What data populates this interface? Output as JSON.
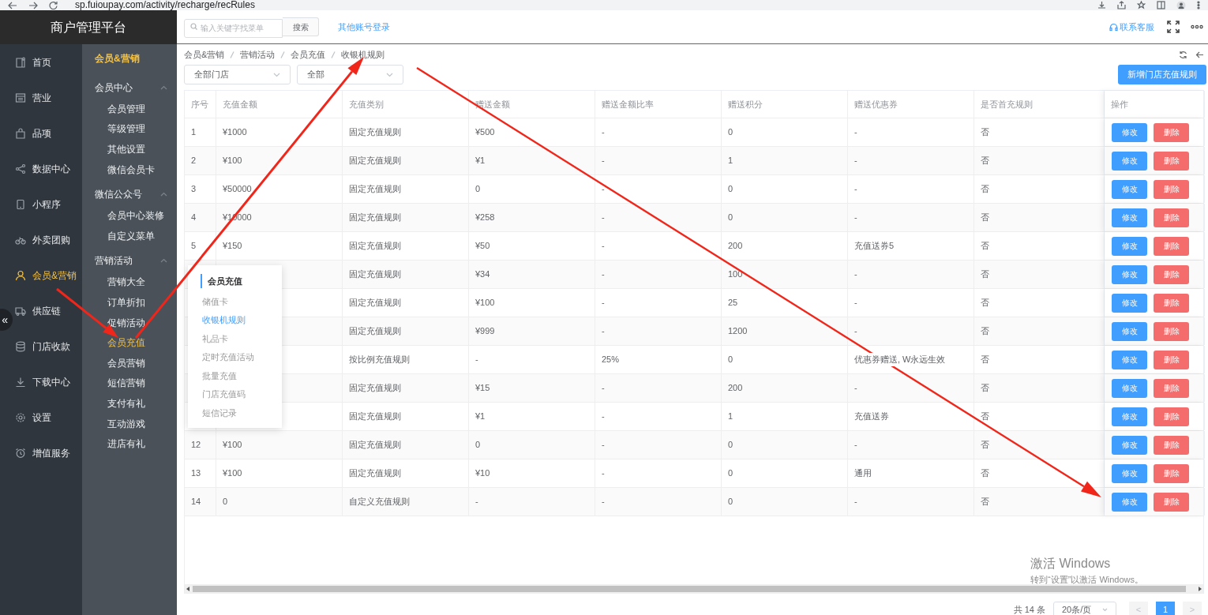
{
  "browser": {
    "url": "sp.fuioupay.com/activity/recharge/recRules"
  },
  "app_title": "商户管理平台",
  "nav": [
    {
      "label": "首页",
      "selected": false
    },
    {
      "label": "营业",
      "selected": false
    },
    {
      "label": "品项",
      "selected": false
    },
    {
      "label": "数据中心",
      "selected": false
    },
    {
      "label": "小程序",
      "selected": false
    },
    {
      "label": "外卖团购",
      "selected": false
    },
    {
      "label": "会员&营销",
      "selected": true
    },
    {
      "label": "供应链",
      "selected": false
    },
    {
      "label": "门店收款",
      "selected": false
    },
    {
      "label": "下载中心",
      "selected": false
    },
    {
      "label": "设置",
      "selected": false
    },
    {
      "label": "增值服务",
      "selected": false
    }
  ],
  "collapse_button": "«",
  "subnav": {
    "title": "会员&营销",
    "groups": [
      {
        "label": "会员中心",
        "expanded": true,
        "children": [
          {
            "label": "会员管理",
            "selected": false
          },
          {
            "label": "等级管理",
            "selected": false
          },
          {
            "label": "其他设置",
            "selected": false
          },
          {
            "label": "微信会员卡",
            "selected": false
          }
        ]
      },
      {
        "label": "微信公众号",
        "expanded": true,
        "children": [
          {
            "label": "会员中心装修",
            "selected": false
          },
          {
            "label": "自定义菜单",
            "selected": false
          }
        ]
      },
      {
        "label": "营销活动",
        "expanded": true,
        "children": [
          {
            "label": "营销大全",
            "selected": false
          },
          {
            "label": "订单折扣",
            "selected": false
          },
          {
            "label": "促销活动",
            "selected": false
          },
          {
            "label": "会员充值",
            "selected": true
          },
          {
            "label": "会员营销",
            "selected": false
          },
          {
            "label": "短信营销",
            "selected": false
          },
          {
            "label": "支付有礼",
            "selected": false
          },
          {
            "label": "互动游戏",
            "selected": false
          },
          {
            "label": "进店有礼",
            "selected": false
          }
        ]
      }
    ]
  },
  "topbar": {
    "search": {
      "placeholder": "输入关键字找菜单",
      "button": "搜索"
    },
    "link": "其他账号登录",
    "support": "联系客服"
  },
  "breadcrumb": [
    "会员&营销",
    "营销活动",
    "会员充值",
    "收银机规则"
  ],
  "filters": [
    {
      "value": "全部门店"
    },
    {
      "value": "全部"
    }
  ],
  "add_button": "新增门店充值规则",
  "table": {
    "columns": [
      "序号",
      "充值金额",
      "充值类别",
      "赠送金额",
      "赠送金额比率",
      "赠送积分",
      "赠送优惠券",
      "是否首充规则",
      "操作"
    ],
    "rows": [
      {
        "no": "1",
        "amount": "¥1000",
        "type": "固定充值规则",
        "bonus": "¥500",
        "ratio": "-",
        "points": "0",
        "coupon": "-",
        "first": "否",
        "actions": [
          "修改",
          "删除"
        ]
      },
      {
        "no": "2",
        "amount": "¥100",
        "type": "固定充值规则",
        "bonus": "¥1",
        "ratio": "-",
        "points": "1",
        "coupon": "-",
        "first": "否",
        "actions": [
          "修改",
          "删除"
        ]
      },
      {
        "no": "3",
        "amount": "¥50000",
        "type": "固定充值规则",
        "bonus": "0",
        "ratio": "-",
        "points": "0",
        "coupon": "-",
        "first": "否",
        "actions": [
          "修改",
          "删除"
        ]
      },
      {
        "no": "4",
        "amount": "¥10000",
        "type": "固定充值规则",
        "bonus": "¥258",
        "ratio": "-",
        "points": "0",
        "coupon": "-",
        "first": "否",
        "actions": [
          "修改",
          "删除"
        ]
      },
      {
        "no": "5",
        "amount": "¥150",
        "type": "固定充值规则",
        "bonus": "¥50",
        "ratio": "-",
        "points": "200",
        "coupon": "充值送券5",
        "first": "否",
        "actions": [
          "修改",
          "删除"
        ]
      },
      {
        "type": "固定充值规则",
        "bonus": "¥34",
        "ratio": "-",
        "points": "100",
        "coupon": "-",
        "first": "否",
        "actions": [
          "修改",
          "删除"
        ]
      },
      {
        "type": "固定充值规则",
        "bonus": "¥100",
        "ratio": "-",
        "points": "25",
        "coupon": "-",
        "first": "否",
        "actions": [
          "修改",
          "删除"
        ]
      },
      {
        "type": "固定充值规则",
        "bonus": "¥999",
        "ratio": "-",
        "points": "1200",
        "coupon": "-",
        "first": "否",
        "actions": [
          "修改",
          "删除"
        ]
      },
      {
        "type": "按比例充值规则",
        "bonus": "-",
        "ratio": "25%",
        "points": "0",
        "coupon": "优惠券赠送, W永远生效",
        "first": "否",
        "actions": [
          "修改",
          "删除"
        ]
      },
      {
        "type": "固定充值规则",
        "bonus": "¥15",
        "ratio": "-",
        "points": "200",
        "coupon": "-",
        "first": "否",
        "actions": [
          "修改",
          "删除"
        ]
      },
      {
        "type": "固定充值规则",
        "bonus": "¥1",
        "ratio": "-",
        "points": "1",
        "coupon": "充值送券",
        "first": "否",
        "actions": [
          "修改",
          "删除"
        ]
      },
      {
        "no": "12",
        "amount": "¥100",
        "type": "固定充值规则",
        "bonus": "0",
        "ratio": "-",
        "points": "0",
        "coupon": "-",
        "first": "否",
        "actions": [
          "修改",
          "删除"
        ]
      },
      {
        "no": "13",
        "amount": "¥100",
        "type": "固定充值规则",
        "bonus": "¥10",
        "ratio": "-",
        "points": "0",
        "coupon": "通用",
        "first": "否",
        "actions": [
          "修改",
          "删除"
        ]
      },
      {
        "no": "14",
        "amount": "0",
        "type": "自定义充值规则",
        "bonus": "-",
        "ratio": "-",
        "points": "0",
        "coupon": "-",
        "first": "否",
        "actions": [
          "修改",
          "删除"
        ]
      }
    ]
  },
  "flyout": {
    "title": "会员充值",
    "items": [
      {
        "label": "储值卡",
        "selected": false
      },
      {
        "label": "收银机规则",
        "selected": true
      },
      {
        "label": "礼品卡",
        "selected": false
      },
      {
        "label": "定时充值活动",
        "selected": false
      },
      {
        "label": "批量充值",
        "selected": false
      },
      {
        "label": "门店充值码",
        "selected": false
      },
      {
        "label": "短信记录",
        "selected": false
      }
    ]
  },
  "pagination": {
    "total": "共 14 条",
    "page_size": "20条/页",
    "prev": "<",
    "next": ">",
    "pages": [
      {
        "label": "1",
        "selected": true
      }
    ]
  },
  "os_watermark": {
    "title": "激活 Windows",
    "subtitle": "转到“设置”以激活 Windows。"
  }
}
